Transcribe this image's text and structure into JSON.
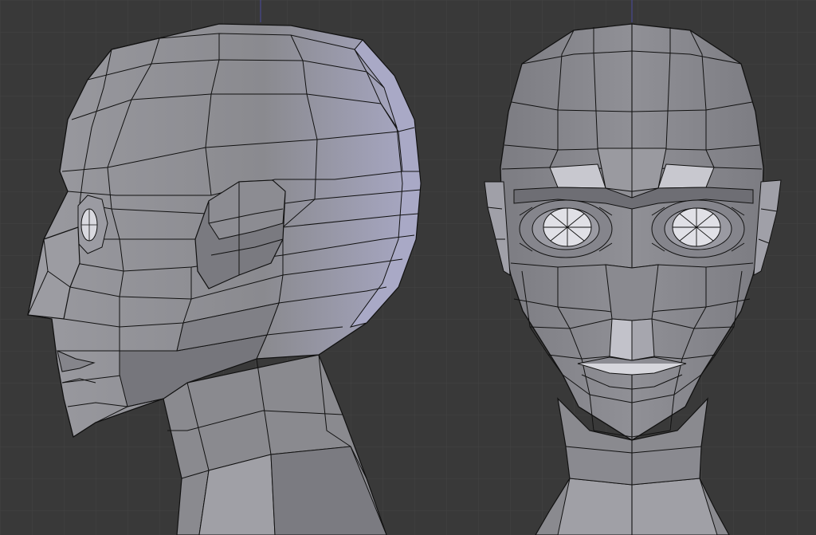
{
  "viewport": {
    "views": [
      {
        "label": "side-view"
      },
      {
        "label": "front-view"
      }
    ]
  },
  "colors": {
    "background": "#393939",
    "grid": "#444444",
    "grid_axis": "#4a4aa0",
    "mesh_base": "#8a8a8f",
    "mesh_light": "#b4b4bb",
    "mesh_dark": "#6a6a70",
    "mesh_rim": "#a9a9c6",
    "wire": "#111111"
  }
}
